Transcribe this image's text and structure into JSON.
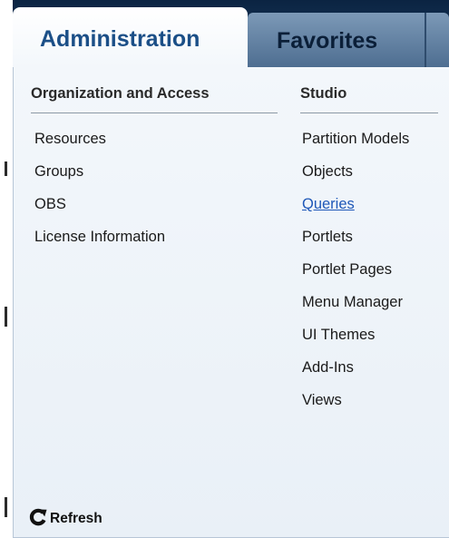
{
  "tabs": {
    "administration": "Administration",
    "favorites": "Favorites"
  },
  "sections": {
    "organization": {
      "heading": "Organization and Access",
      "items": [
        "Resources",
        "Groups",
        "OBS",
        "License Information"
      ]
    },
    "studio": {
      "heading": "Studio",
      "items": [
        "Partition Models",
        "Objects",
        "Queries",
        "Portlets",
        "Portlet Pages",
        "Menu Manager",
        "UI Themes",
        "Add-Ins",
        "Views"
      ]
    }
  },
  "footer": {
    "refresh_label": "Refresh"
  },
  "icons": {
    "refresh": "refresh-icon"
  },
  "colors": {
    "active_tab_text": "#1b4f87",
    "inactive_tab_bg": "#5f7fa2",
    "link": "#1f58b8",
    "header_bar": "#0b2442"
  }
}
